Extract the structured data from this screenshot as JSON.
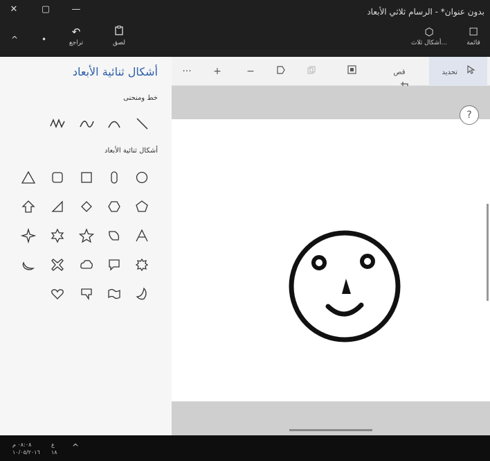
{
  "window": {
    "title": "بدون عنوان* - الرسام ثلاثي الأبعاد",
    "close_glyph": "✕",
    "max_glyph": "▢",
    "min_glyph": "—"
  },
  "ribbon": {
    "menu": {
      "icon": "menu-icon",
      "label": "قائمة",
      "glyph": "☐"
    },
    "shapes3d": {
      "icon": "cube-icon",
      "label": "أشكال ثلاث...",
      "glyph": "⬡"
    },
    "paste": {
      "icon": "paste-icon",
      "label": "لصق",
      "glyph": "📋"
    },
    "undo": {
      "icon": "undo-icon",
      "label": "تراجع",
      "glyph": "↶"
    },
    "collapse_glyph": "^",
    "dot_glyph": "•"
  },
  "panel": {
    "title": "أشكال ثنائية الأبعاد",
    "lines_section": "خط ومنحنى",
    "shapes_section": "أشكال ثنائية الأبعاد"
  },
  "toolbar": {
    "select_label": "تحديد",
    "crop_label": "قص",
    "more_glyph": "···",
    "plus_glyph": "+",
    "minus_glyph": "−"
  },
  "help": {
    "glyph": "?"
  },
  "taskbar": {
    "time": "٠٨:٠٨ م",
    "date": "١٠/٠٥/٢٠١٦",
    "lang": "ع",
    "lang_sub": "١٨",
    "chevron_glyph": "^"
  }
}
